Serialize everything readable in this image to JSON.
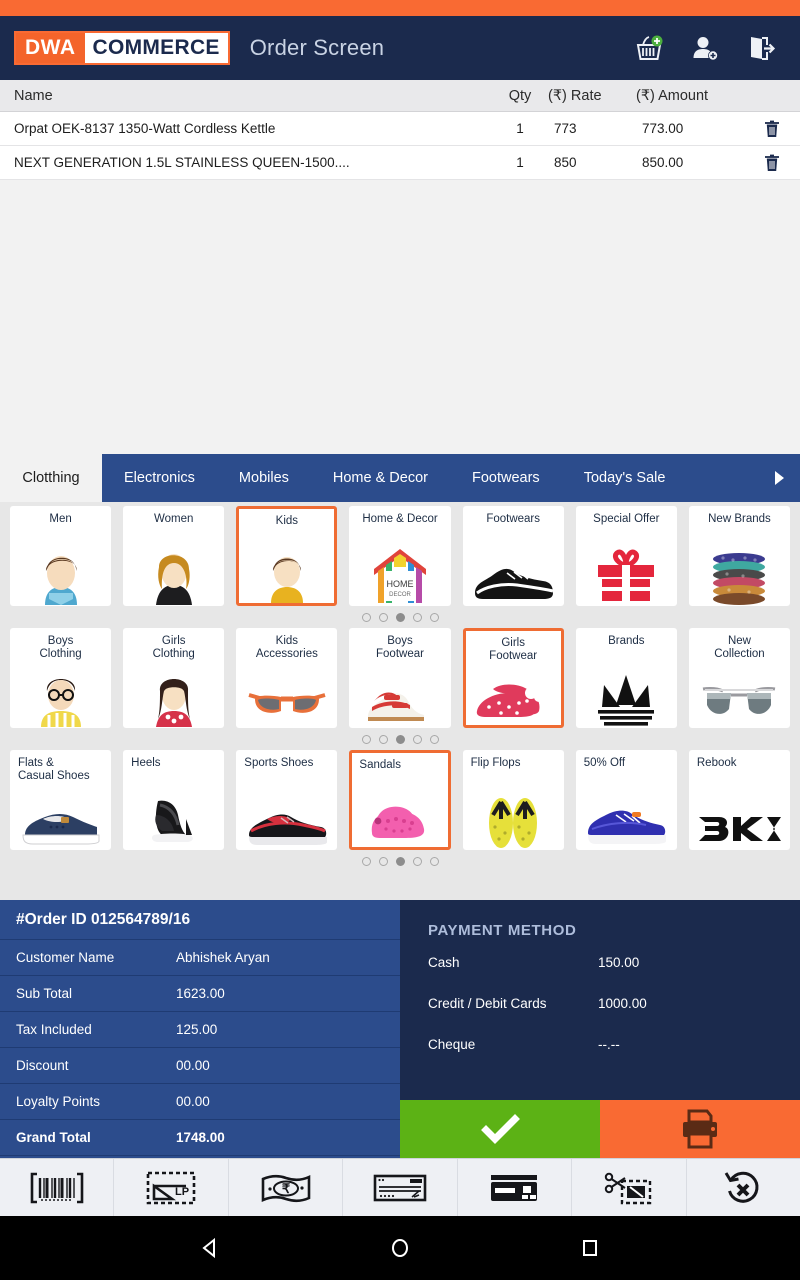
{
  "app": {
    "logo_primary": "DWA",
    "logo_secondary": "COMMERCE",
    "screen_title": "Order Screen",
    "accent_orange": "#f96a33",
    "header_navy": "#1b2a4d",
    "tab_blue": "#2c4c8c",
    "confirm_green": "#5cb215"
  },
  "header": {
    "icons": [
      {
        "name": "add-to-basket-icon",
        "label": "Add to basket"
      },
      {
        "name": "add-customer-icon",
        "label": "Add customer"
      },
      {
        "name": "logout-icon",
        "label": "Logout"
      }
    ]
  },
  "cart": {
    "columns": [
      "Name",
      "Qty",
      "(₹) Rate",
      "(₹) Amount"
    ],
    "rows": [
      {
        "name": "Orpat OEK-8137 1350-Watt Cordless Kettle",
        "qty": "1",
        "rate": "773",
        "amount": "773.00",
        "delete": "delete-icon"
      },
      {
        "name": "NEXT GENERATION 1.5L STAINLESS QUEEN-1500....",
        "qty": "1",
        "rate": "850",
        "amount": "850.00",
        "delete": "delete-icon"
      }
    ]
  },
  "tabs": {
    "items": [
      {
        "label": "Clotthing",
        "active": true
      },
      {
        "label": "Electronics",
        "active": false
      },
      {
        "label": "Mobiles",
        "active": false
      },
      {
        "label": "Home & Decor",
        "active": false
      },
      {
        "label": "Footwears",
        "active": false
      },
      {
        "label": "Today's Sale",
        "active": false
      }
    ],
    "more_arrow": "chevron-right-icon"
  },
  "grid": {
    "rows": [
      {
        "align": "center",
        "dots": {
          "count": 5,
          "active": 3
        },
        "cards": [
          {
            "label": "Men",
            "art": "man-avatar",
            "selected": false
          },
          {
            "label": "Women",
            "art": "woman-avatar",
            "selected": false
          },
          {
            "label": "Kids",
            "art": "kid-avatar",
            "selected": true
          },
          {
            "label": "Home & Decor",
            "art": "home-decor",
            "selected": false
          },
          {
            "label": "Footwears",
            "art": "sneaker-black",
            "selected": false
          },
          {
            "label": "Special Offer",
            "art": "gift-box",
            "selected": false
          },
          {
            "label": "New Brands",
            "art": "bracelets",
            "selected": false
          }
        ]
      },
      {
        "align": "center",
        "dots": {
          "count": 5,
          "active": 3
        },
        "cards": [
          {
            "label": "Boys\nClothing",
            "art": "boy-photo",
            "selected": false
          },
          {
            "label": "Girls\nClothing",
            "art": "girl-photo",
            "selected": false
          },
          {
            "label": "Kids\nAccessories",
            "art": "sunglasses-orange",
            "selected": false
          },
          {
            "label": "Boys\nFootwear",
            "art": "red-kid-shoes",
            "selected": false
          },
          {
            "label": "Girls\nFootwear",
            "art": "red-flats",
            "selected": true
          },
          {
            "label": "Brands",
            "art": "adidas-logo",
            "selected": false
          },
          {
            "label": "New\nCollection",
            "art": "aviator-sunglasses",
            "selected": false
          }
        ]
      },
      {
        "align": "left",
        "dots": {
          "count": 5,
          "active": 3
        },
        "cards": [
          {
            "label": "Flats &\nCasual Shoes",
            "art": "blue-slipon",
            "selected": false
          },
          {
            "label": "Heels",
            "art": "black-heel",
            "selected": false
          },
          {
            "label": "Sports Shoes",
            "art": "sports-shoe",
            "selected": false
          },
          {
            "label": "Sandals",
            "art": "pink-clog",
            "selected": true
          },
          {
            "label": "Flip Flops",
            "art": "yellow-flipflops",
            "selected": false
          },
          {
            "label": "50% Off",
            "art": "blue-sneaker",
            "selected": false
          },
          {
            "label": "Rebook",
            "art": "rbk-logo",
            "selected": false
          }
        ]
      }
    ]
  },
  "summary": {
    "title": "#Order ID 012564789/16",
    "rows": [
      {
        "key": "Customer Name",
        "value": "Abhishek Aryan"
      },
      {
        "key": "Sub Total",
        "value": "1623.00"
      },
      {
        "key": "Tax Included",
        "value": "125.00"
      },
      {
        "key": "Discount",
        "value": "00.00"
      },
      {
        "key": "Loyalty Points",
        "value": "00.00"
      },
      {
        "key": "Grand Total",
        "value": "1748.00"
      }
    ]
  },
  "payment": {
    "title": "PAYMENT  METHOD",
    "rows": [
      {
        "key": "Cash",
        "value": "150.00"
      },
      {
        "key": "Credit / Debit Cards",
        "value": "1000.00"
      },
      {
        "key": "Cheque",
        "value": "--.--"
      }
    ],
    "confirm_icon": "check-icon",
    "print_icon": "printer-icon"
  },
  "toolbar": {
    "items": [
      {
        "name": "barcode-scan-icon",
        "label": "Barcode"
      },
      {
        "name": "loyalty-card-icon",
        "label": "Loyalty Points"
      },
      {
        "name": "cash-note-icon",
        "label": "Cash"
      },
      {
        "name": "cheque-icon",
        "label": "Cheque"
      },
      {
        "name": "credit-card-icon",
        "label": "Card"
      },
      {
        "name": "coupon-cut-icon",
        "label": "Coupon"
      },
      {
        "name": "cancel-order-icon",
        "label": "Cancel"
      }
    ]
  },
  "navbar": {
    "items": [
      {
        "name": "android-back-icon"
      },
      {
        "name": "android-home-icon"
      },
      {
        "name": "android-recents-icon"
      }
    ]
  }
}
